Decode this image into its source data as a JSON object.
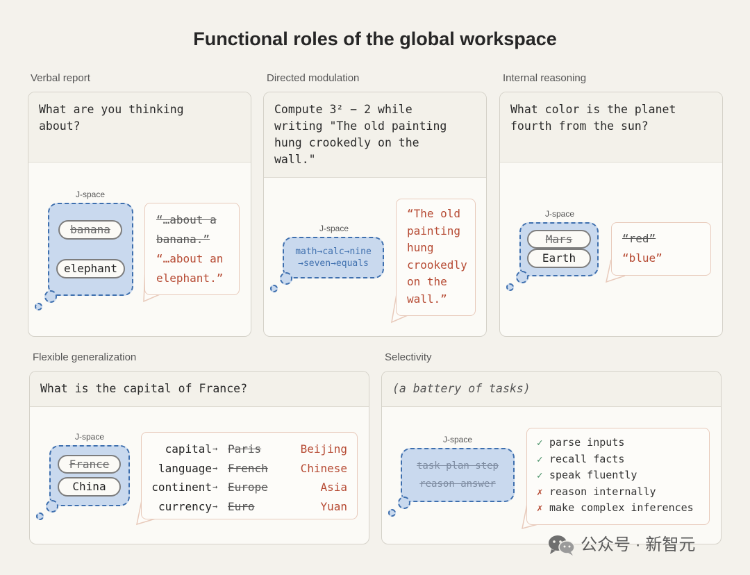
{
  "title": "Functional roles of the global workspace",
  "jspace_label": "J-space",
  "verbal": {
    "label": "Verbal report",
    "prompt": "What are you thinking\nabout?",
    "pills": [
      "banana",
      "elephant"
    ],
    "outputs": [
      "“…about a",
      "banana.”",
      "“…about an",
      "elephant.”"
    ]
  },
  "directed": {
    "label": "Directed modulation",
    "prompt": "Compute 3² − 2 while\nwriting \"The old painting\nhung crookedly on the\nwall.\"",
    "jspace_line1": "math→calc→nine",
    "jspace_line2": "→seven→equals",
    "outputs": [
      "“The old",
      "painting",
      "hung",
      "crookedly",
      "on the",
      "wall.”"
    ]
  },
  "internal": {
    "label": "Internal reasoning",
    "prompt": "What color is the planet\nfourth from the sun?",
    "pills": [
      "Mars",
      "Earth"
    ],
    "outputs": [
      "“red”",
      "“blue”"
    ]
  },
  "flexible": {
    "label": "Flexible generalization",
    "prompt": "What is the capital of France?",
    "pills": [
      "France",
      "China"
    ],
    "rows": [
      {
        "attr": "capital",
        "old": "Paris",
        "new": "Beijing"
      },
      {
        "attr": "language",
        "old": "French",
        "new": "Chinese"
      },
      {
        "attr": "continent",
        "old": "Europe",
        "new": "Asia"
      },
      {
        "attr": "currency",
        "old": "Euro",
        "new": "Yuan"
      }
    ]
  },
  "selectivity": {
    "label": "Selectivity",
    "prompt": "(a battery of tasks)",
    "jspace_line1": "task plan step",
    "jspace_line2": "reason answer",
    "tasks": [
      {
        "mark": "✓",
        "text": "parse inputs"
      },
      {
        "mark": "✓",
        "text": "recall facts"
      },
      {
        "mark": "✓",
        "text": "speak fluently"
      },
      {
        "mark": "✗",
        "text": "reason internally"
      },
      {
        "mark": "✗",
        "text": "make complex inferences"
      }
    ]
  },
  "watermark": "公众号 · 新智元",
  "colors": {
    "jspace_fill": "#c9d9ee",
    "jspace_border": "#3e6fae",
    "output_red": "#b64a33",
    "check_green": "#3c8a5e"
  }
}
